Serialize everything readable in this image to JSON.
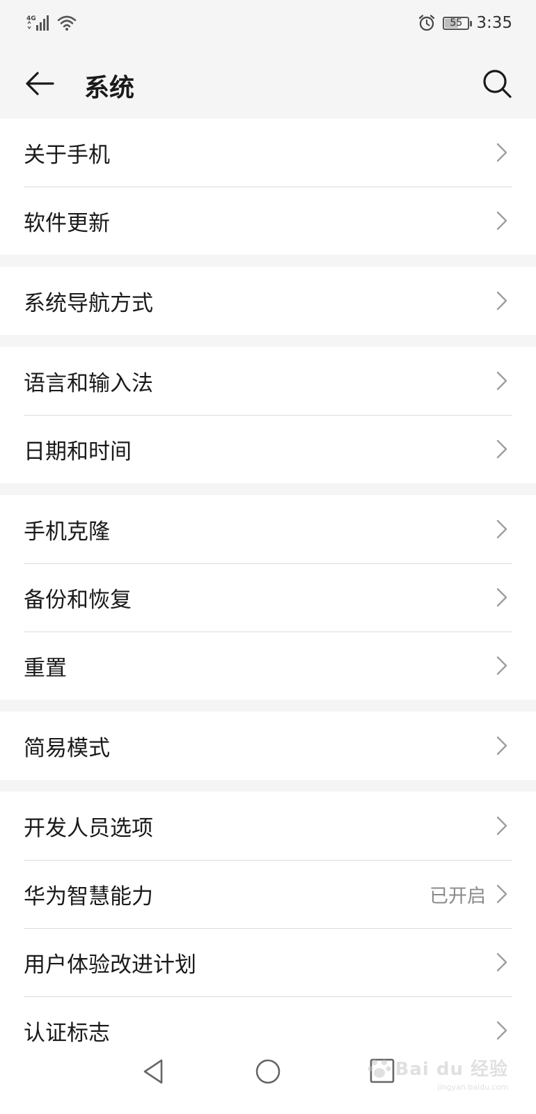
{
  "status_bar": {
    "network": "4G",
    "battery": "55",
    "time": "3:35"
  },
  "header": {
    "title": "系统"
  },
  "groups": [
    [
      {
        "label": "关于手机"
      },
      {
        "label": "软件更新"
      }
    ],
    [
      {
        "label": "系统导航方式"
      }
    ],
    [
      {
        "label": "语言和输入法"
      },
      {
        "label": "日期和时间"
      }
    ],
    [
      {
        "label": "手机克隆"
      },
      {
        "label": "备份和恢复"
      },
      {
        "label": "重置"
      }
    ],
    [
      {
        "label": "简易模式"
      }
    ],
    [
      {
        "label": "开发人员选项"
      },
      {
        "label": "华为智慧能力",
        "value": "已开启"
      },
      {
        "label": "用户体验改进计划"
      },
      {
        "label": "认证标志"
      }
    ]
  ],
  "watermark": {
    "brand": "Bai du 经验",
    "url": "jingyan.baidu.com"
  },
  "colors": {
    "background": "#f5f5f5",
    "card": "#ffffff",
    "divider": "#dcdcdc",
    "secondary_text": "#8a8a8a",
    "chevron": "#9e9e9e"
  }
}
